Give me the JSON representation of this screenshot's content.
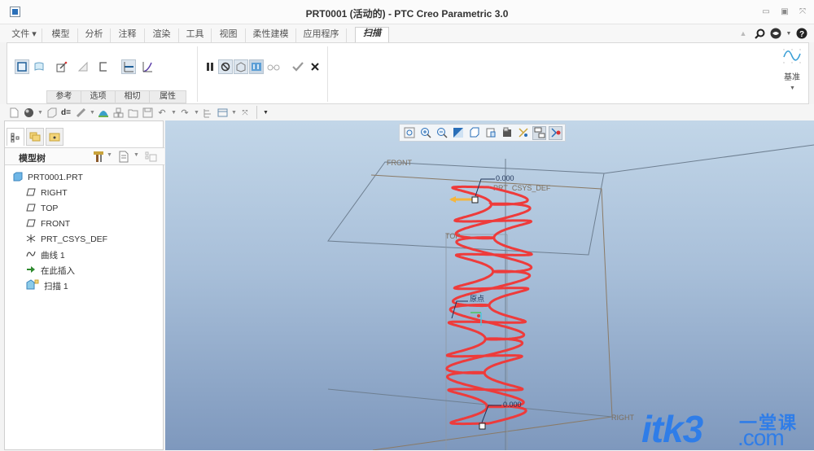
{
  "window": {
    "title": "PRT0001 (活动的) - PTC Creo Parametric 3.0",
    "controls": [
      "minimize-icon",
      "restore-icon",
      "close-icon"
    ]
  },
  "ribbon_tabs": [
    {
      "label": "文件 ▾",
      "active": false
    },
    {
      "label": "模型",
      "active": false
    },
    {
      "label": "分析",
      "active": false
    },
    {
      "label": "注释",
      "active": false
    },
    {
      "label": "渲染",
      "active": false
    },
    {
      "label": "工具",
      "active": false
    },
    {
      "label": "视图",
      "active": false
    },
    {
      "label": "柔性建模",
      "active": false
    },
    {
      "label": "应用程序",
      "active": false
    },
    {
      "label": "扫描",
      "active": true
    }
  ],
  "header_right_icons": [
    "collapse-ribbon-icon",
    "search-icon",
    "community-icon",
    "dropdown-icon",
    "help-icon"
  ],
  "sweep_ribbon": {
    "buttons": [
      {
        "name": "solid-sweep",
        "selected": true
      },
      {
        "name": "surface-sweep",
        "selected": false
      },
      {
        "name": "edit-sketch",
        "selected": false
      },
      {
        "name": "remove-material",
        "selected": false
      },
      {
        "name": "thicken",
        "selected": false
      },
      {
        "name": "constant-section",
        "selected": true
      },
      {
        "name": "variable-section",
        "selected": false
      }
    ],
    "control_buttons": [
      "pause",
      "no-preview",
      "geometry-preview",
      "verify-preview",
      "glasses-preview",
      "ok",
      "cancel"
    ],
    "subtabs": [
      "参考",
      "选项",
      "相切",
      "属性"
    ],
    "datum_label": "基准"
  },
  "quick_access": [
    "new",
    "appearance",
    "datum-display",
    "dimension",
    "pen",
    "render",
    "assembly",
    "open",
    "save",
    "undo",
    "redo",
    "regenerate",
    "window",
    "close",
    "more"
  ],
  "left_panel": {
    "nav_tabs": [
      "model-tree",
      "folder-browser",
      "favorites"
    ],
    "tree_title": "模型树",
    "tree_items": [
      {
        "label": "PRT0001.PRT",
        "icon": "part-icon",
        "level": 0
      },
      {
        "label": "RIGHT",
        "icon": "datum-plane-icon",
        "level": 1
      },
      {
        "label": "TOP",
        "icon": "datum-plane-icon",
        "level": 1
      },
      {
        "label": "FRONT",
        "icon": "datum-plane-icon",
        "level": 1
      },
      {
        "label": "PRT_CSYS_DEF",
        "icon": "csys-icon",
        "level": 1
      },
      {
        "label": "曲线 1",
        "icon": "curve-icon",
        "level": 1
      },
      {
        "label": "在此插入",
        "icon": "insert-arrow-icon",
        "level": 1
      },
      {
        "label": "扫描 1",
        "icon": "sweep-icon",
        "level": 1
      }
    ]
  },
  "viewport": {
    "toolbar": [
      "refit",
      "zoom-in",
      "zoom-out",
      "repaint",
      "view-orientation",
      "saved-views",
      "display-style",
      "datum-display",
      "annotation-display",
      "spin-center"
    ],
    "labels": {
      "front": "FRONT",
      "top": "TOP",
      "right": "RIGHT",
      "csys": "PRT_CSYS_DEF",
      "origin": "原点",
      "dim_top": "0.000",
      "dim_bottom": "0.000"
    },
    "curve_color": "#ee3b3b",
    "plane_color": "#8a7a66"
  },
  "watermark": {
    "main": "itk3",
    "dot": ".com",
    "cn": "一堂课"
  }
}
